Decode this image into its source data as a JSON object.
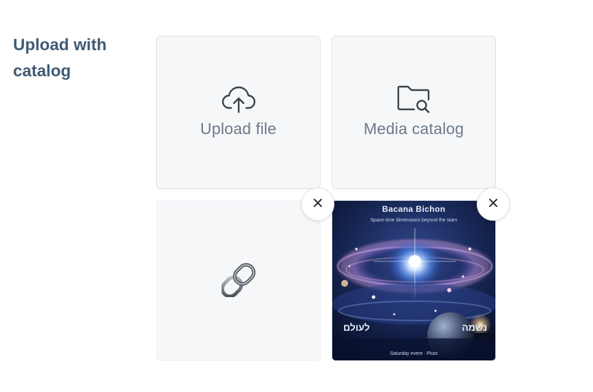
{
  "field": {
    "label": "Upload with catalog"
  },
  "tiles": {
    "upload": {
      "label": "Upload file",
      "icon": "cloud-upload-icon"
    },
    "catalog": {
      "label": "Media catalog",
      "icon": "folder-search-icon"
    },
    "link": {
      "icon": "link-chain-icon"
    }
  },
  "remove_buttons": {
    "icon": "close-icon"
  },
  "image": {
    "title": "Bacana Bichon",
    "subtitle": "Space-time dimensions beyond the stars",
    "left_text": "לעולם",
    "right_text": "נשמה",
    "footer": "Saturday event · Pluto"
  },
  "colors": {
    "label_text": "#3f5b75",
    "tile_bg": "#f6f7f9",
    "tile_border": "#dee2e6",
    "tile_text": "#6b7a88",
    "icon_stroke": "#3a4048"
  }
}
